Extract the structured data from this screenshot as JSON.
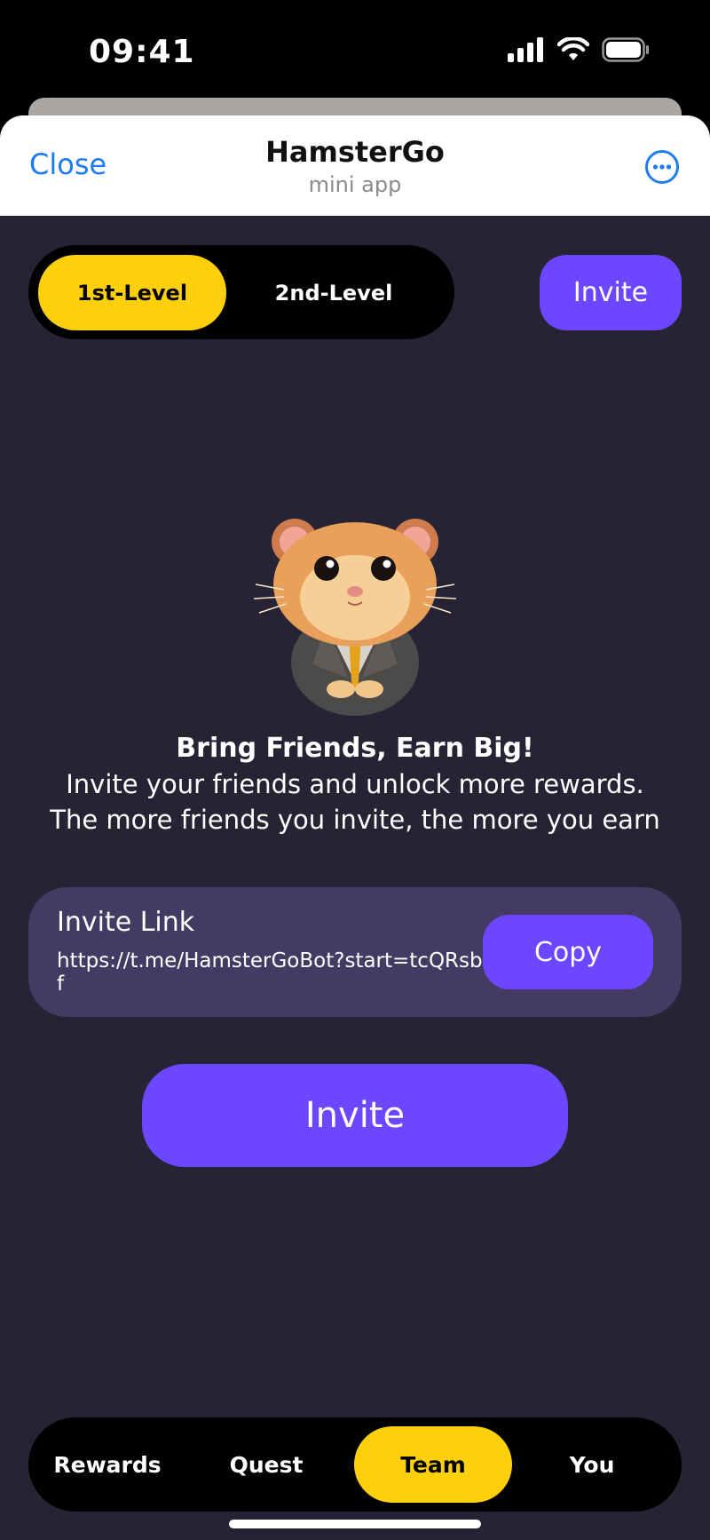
{
  "status_bar": {
    "time": "09:41"
  },
  "header": {
    "close_label": "Close",
    "title": "HamsterGo",
    "subtitle": "mini app"
  },
  "tabs": {
    "first": "1st-Level",
    "second": "2nd-Level",
    "active": "1st-Level"
  },
  "invite_top_label": "Invite",
  "promo": {
    "title": "Bring Friends, Earn Big!",
    "line1": "Invite your friends and unlock more rewards.",
    "line2": "The more friends you invite, the more you earn"
  },
  "link_card": {
    "label": "Invite Link",
    "url": "https://t.me/HamsterGoBot?start=tcQRsbHf",
    "copy_label": "Copy"
  },
  "invite_main_label": "Invite",
  "nav": {
    "items": [
      {
        "label": "Rewards"
      },
      {
        "label": "Quest"
      },
      {
        "label": "Team"
      },
      {
        "label": "You"
      }
    ],
    "active": "Team"
  },
  "colors": {
    "accent_purple": "#6c47ff",
    "accent_yellow": "#fdd00b",
    "background": "#262335",
    "card": "#433b63",
    "link_blue": "#1c7cf0"
  },
  "icons": [
    "signal-icon",
    "wifi-icon",
    "battery-icon",
    "more-options-icon",
    "hamster-mascot"
  ]
}
